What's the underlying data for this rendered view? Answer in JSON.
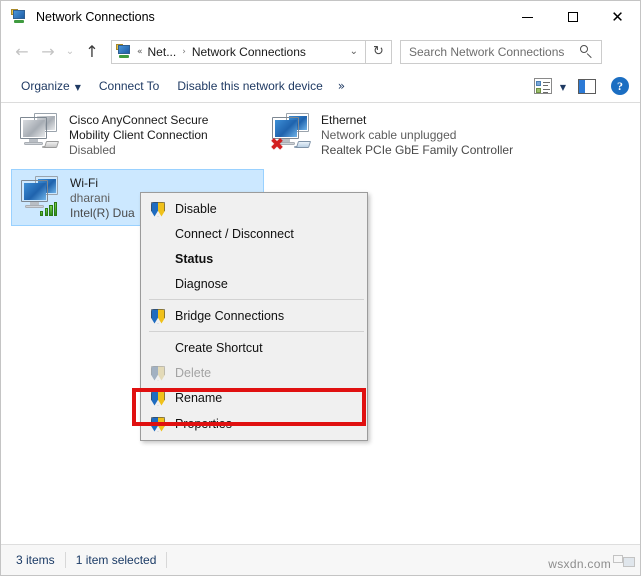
{
  "window": {
    "title": "Network Connections",
    "title_icon": "network-connections-icon",
    "minimize_label": "—",
    "maximize_label": "",
    "close_label": "✕"
  },
  "navbar": {
    "back_icon": "←",
    "forward_icon": "→",
    "recent_icon": "⌄",
    "up_icon": "↑",
    "address_icon": "network-connections-icon",
    "breadcrumb_overflow": "«",
    "breadcrumb": [
      {
        "label": "Net..."
      },
      {
        "label": "Network Connections"
      }
    ],
    "breadcrumb_separator": "›",
    "dropdown_icon": "⌄",
    "refresh_icon": "↻",
    "search_placeholder": "Search Network Connections",
    "search_value": ""
  },
  "toolbar": {
    "organize_label": "Organize",
    "organize_caret": "▼",
    "connect_to_label": "Connect To",
    "disable_device_label": "Disable this network device",
    "overflow_label": "»",
    "view_options_icon": "view-options-icon",
    "view_caret": "▼",
    "preview_pane_icon": "preview-pane-icon",
    "help_icon": "?"
  },
  "adapters": [
    {
      "name": "Cisco AnyConnect Secure Mobility Client Connection",
      "status": "Disabled",
      "device": "",
      "icon": "network-adapter-disabled-icon",
      "selected": false,
      "state": "disabled"
    },
    {
      "name": "Ethernet",
      "status": "Network cable unplugged",
      "device": "Realtek PCIe GbE Family Controller",
      "icon": "network-adapter-unplugged-icon",
      "selected": false,
      "state": "unplugged"
    },
    {
      "name": "Wi-Fi",
      "status": "dharani",
      "device": "Intel(R) Dua",
      "icon": "wifi-adapter-icon",
      "selected": true,
      "state": "connected"
    }
  ],
  "context_menu": {
    "items": [
      {
        "label": "Disable",
        "shield": true,
        "bold": false,
        "disabled": false,
        "type": "item"
      },
      {
        "label": "Connect / Disconnect",
        "shield": false,
        "bold": false,
        "disabled": false,
        "type": "item"
      },
      {
        "label": "Status",
        "shield": false,
        "bold": true,
        "disabled": false,
        "type": "item"
      },
      {
        "label": "Diagnose",
        "shield": false,
        "bold": false,
        "disabled": false,
        "type": "item"
      },
      {
        "type": "separator"
      },
      {
        "label": "Bridge Connections",
        "shield": true,
        "bold": false,
        "disabled": false,
        "type": "item"
      },
      {
        "type": "separator"
      },
      {
        "label": "Create Shortcut",
        "shield": false,
        "bold": false,
        "disabled": false,
        "type": "item"
      },
      {
        "label": "Delete",
        "shield": true,
        "bold": false,
        "disabled": true,
        "type": "item"
      },
      {
        "label": "Rename",
        "shield": true,
        "bold": false,
        "disabled": false,
        "type": "item"
      },
      {
        "label": "Properties",
        "shield": true,
        "bold": false,
        "disabled": false,
        "type": "item",
        "highlighted": true
      }
    ]
  },
  "statusbar": {
    "item_count": "3 items",
    "selection": "1 item selected"
  },
  "watermark": {
    "text": "wsxdn.com"
  },
  "colors": {
    "selection_blue": "#cce8ff",
    "highlight_red": "#e01010",
    "link_blue": "#1f3a63",
    "shield_blue": "#1f6cc0",
    "shield_gold": "#f0c11b",
    "signal_green": "#2f8f18",
    "error_red": "#d31f1f"
  }
}
